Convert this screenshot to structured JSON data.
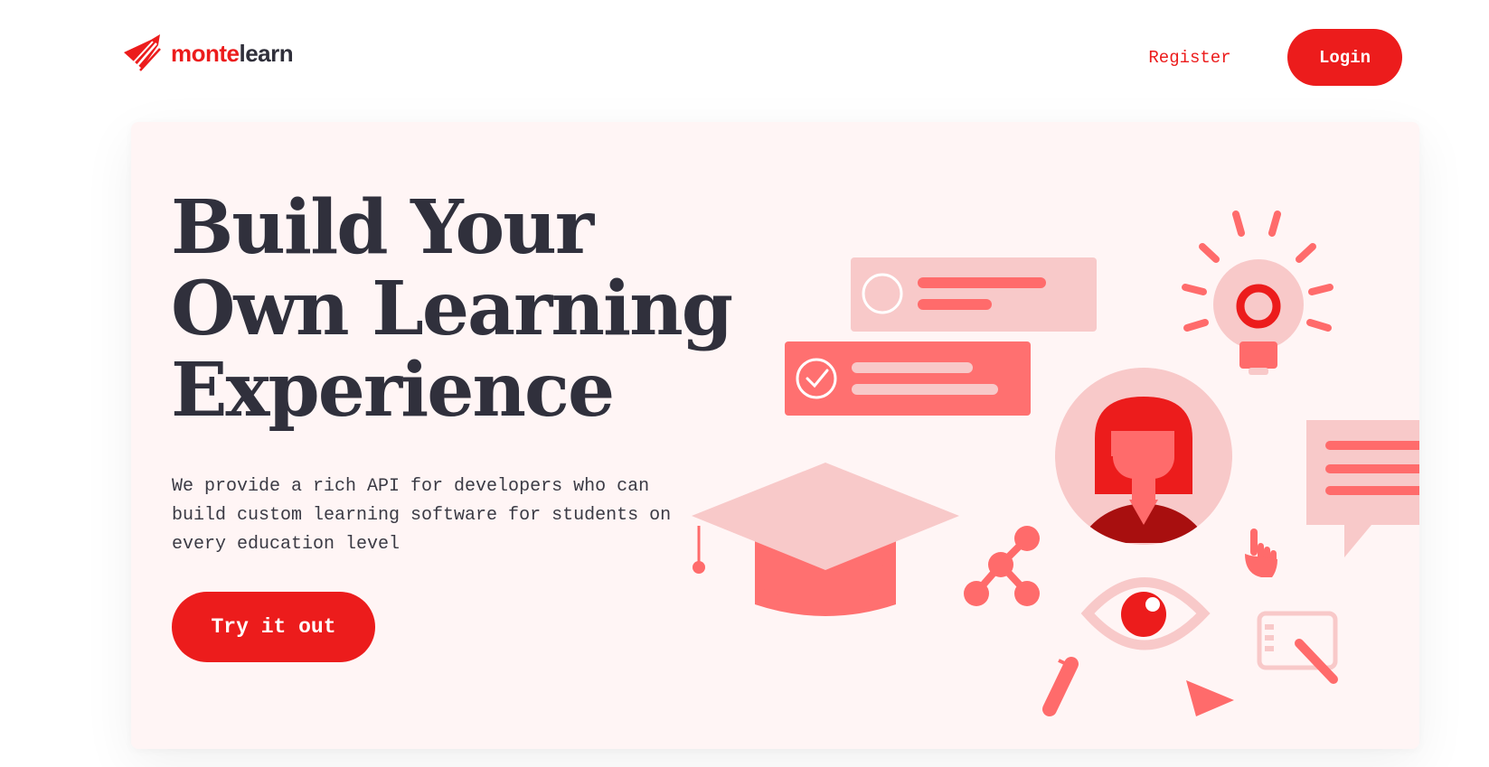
{
  "brand": {
    "name_part1": "monte",
    "name_part2": "learn",
    "accent_color": "#ec1c1c",
    "dark_color": "#2f2f3a"
  },
  "nav": {
    "register_label": "Register",
    "login_label": "Login"
  },
  "hero": {
    "title_lines": [
      "Build Your",
      "Own Learning",
      "Experience"
    ],
    "description_lines": [
      "We provide a rich API for developers who can",
      "build custom learning software for students on",
      "every education level"
    ],
    "cta_label": "Try it out",
    "background_color": "#fff5f5"
  },
  "illustration": {
    "icons": [
      "task-card-unchecked-icon",
      "task-card-checked-icon",
      "lightbulb-icon",
      "user-avatar-icon",
      "speech-bubble-icon",
      "graduation-cap-icon",
      "share-nodes-icon",
      "eye-icon",
      "hand-pointer-icon",
      "drawing-tablet-icon",
      "pen-icon",
      "cursor-arrow-icon"
    ]
  }
}
